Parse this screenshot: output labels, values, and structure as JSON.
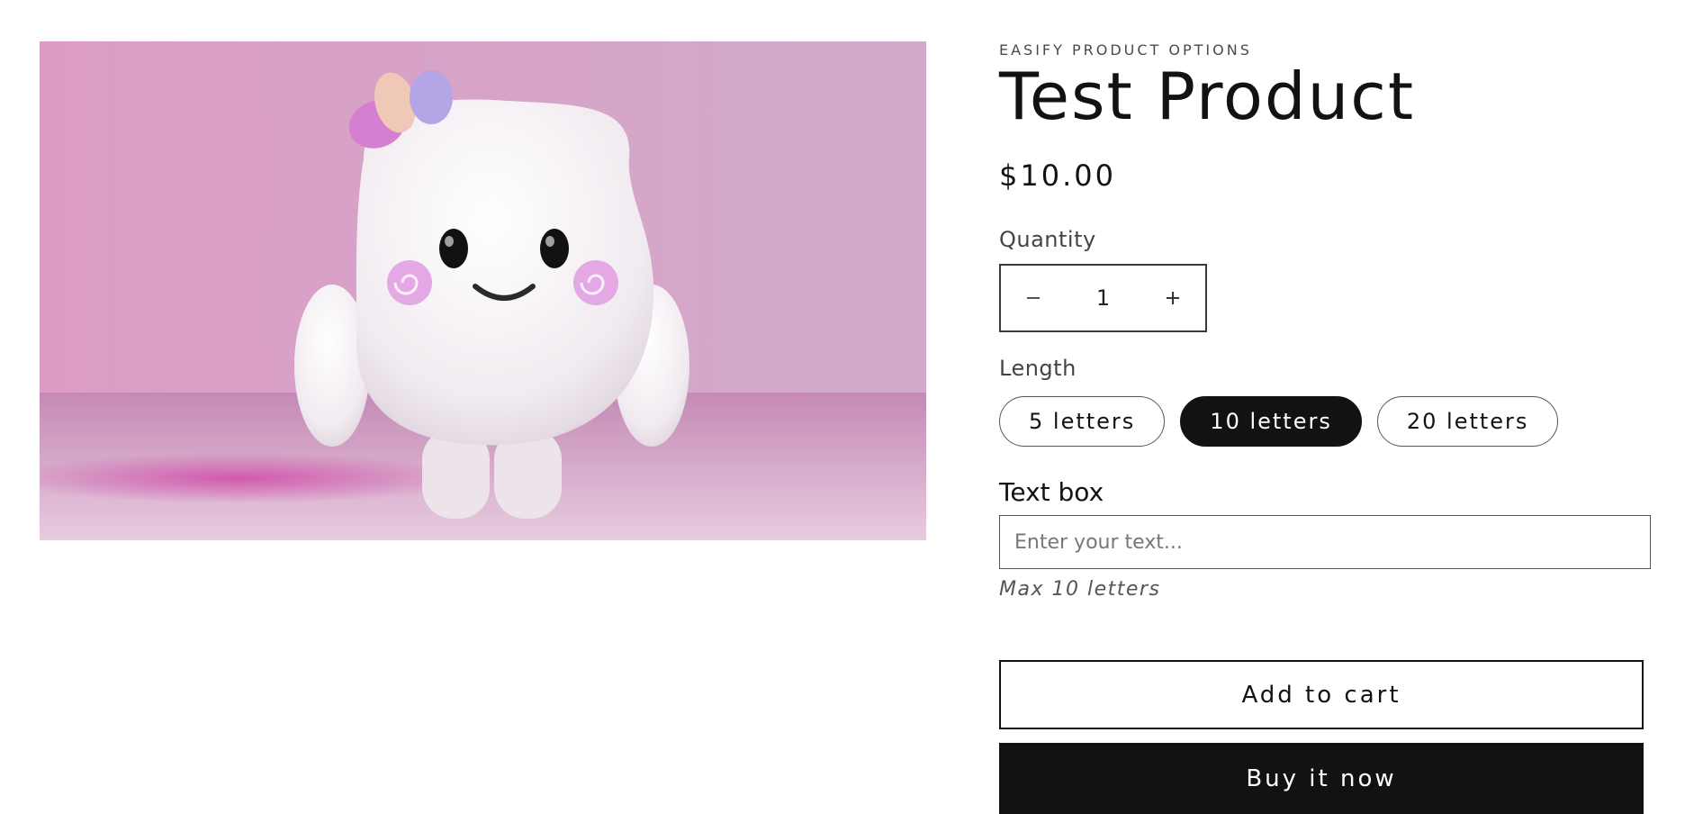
{
  "product": {
    "vendor": "EASIFY PRODUCT OPTIONS",
    "title": "Test Product",
    "price": "$10.00",
    "image_alt": "Pink marshmallow character figure"
  },
  "quantity": {
    "label": "Quantity",
    "value": "1",
    "minus_icon": "minus-icon",
    "plus_icon": "plus-icon"
  },
  "length": {
    "label": "Length",
    "options": [
      "5 letters",
      "10 letters",
      "20 letters"
    ],
    "selected": "10 letters"
  },
  "text_box": {
    "label": "Text box",
    "placeholder": "Enter your text...",
    "value": "",
    "hint": "Max 10 letters"
  },
  "actions": {
    "add_to_cart": "Add to cart",
    "buy_now": "Buy it now"
  },
  "colors": {
    "accent": "#121212",
    "background": "#ffffff",
    "image_background": "#d9a6c9"
  }
}
